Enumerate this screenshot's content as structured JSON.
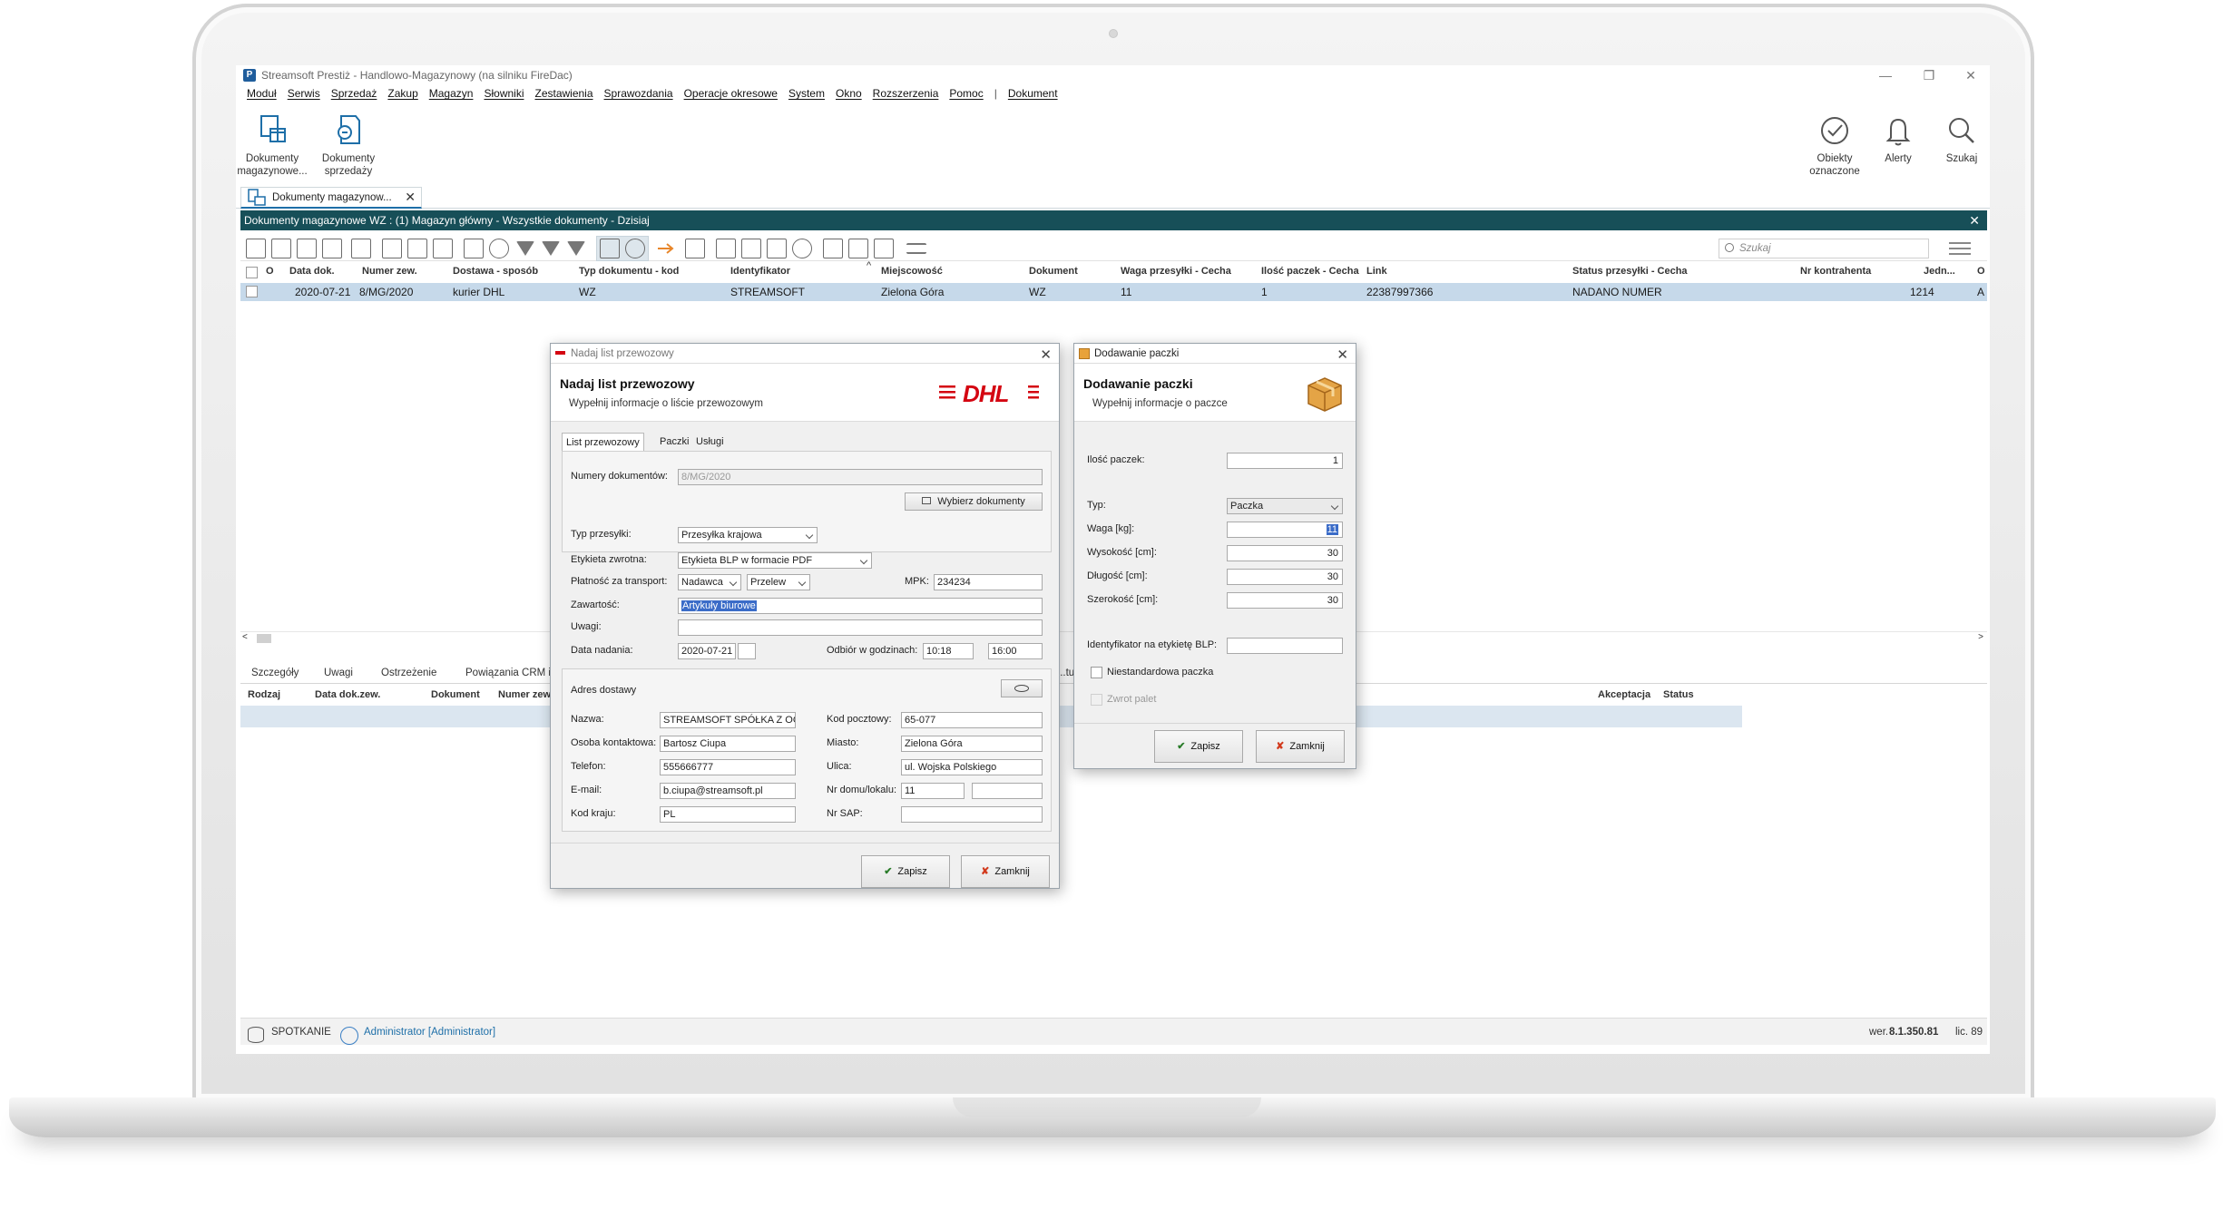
{
  "window": {
    "title": "Streamsoft Prestiż - Handlowo-Magazynowy (na silniku FireDac)",
    "app_letter": "P",
    "minimize": "—",
    "maximize": "❐",
    "close": "✕"
  },
  "menu": [
    "Moduł",
    "Serwis",
    "Sprzedaż",
    "Zakup",
    "Magazyn",
    "Słowniki",
    "Zestawienia",
    "Sprawozdania",
    "Operacje okresowe",
    "System",
    "Okno",
    "Rozszerzenia",
    "Pomoc",
    "|",
    "Dokument"
  ],
  "ribbon": {
    "docs_warehouse": "Dokumenty magazynowe...",
    "docs_sales": "Dokumenty sprzedaży",
    "marked": "Obiekty oznaczone",
    "alerts": "Alerty",
    "search": "Szukaj"
  },
  "doc_tab": {
    "label": "Dokumenty magazynow...",
    "close": "✕"
  },
  "breadcrumb": "Dokumenty magazynowe WZ : (1) Magazyn główny - Wszystkie dokumenty - Dzisiaj",
  "toolbar": {
    "search_placeholder": "Szukaj"
  },
  "grid": {
    "headers": {
      "mark": "O",
      "date": "Data dok.",
      "ext_no": "Numer zew.",
      "delivery": "Dostawa - sposób",
      "doc_type": "Typ dokumentu - kod",
      "identifier": "Identyfikator",
      "city": "Miejscowość",
      "document": "Dokument",
      "weight": "Waga przesyłki - Cecha",
      "packages": "Ilość paczek - Cecha",
      "link": "Link",
      "status": "Status przesyłki - Cecha",
      "contractor": "Nr kontrahenta",
      "unit": "Jedn...",
      "last": "O"
    },
    "row": {
      "date": "2020-07-21",
      "ext_no": "8/MG/2020",
      "delivery": "kurier DHL",
      "doc_type": "WZ",
      "identifier": "STREAMSOFT",
      "city": "Zielona Góra",
      "document": "WZ",
      "weight": "11",
      "packages": "1",
      "link": "22387997366",
      "status": "NADANO NUMER",
      "contractor": "1214",
      "unit": "A"
    }
  },
  "bottom_tabs": [
    "Szczegóły",
    "Uwagi",
    "Ostrzeżenie",
    "Powiązania CRM i ...",
    "...tu"
  ],
  "bottom_headers": {
    "kind": "Rodzaj",
    "date": "Data dok.zew.",
    "document": "Dokument",
    "number": "Numer zew...",
    "accept": "Akceptacja",
    "status": "Status"
  },
  "statusbar": {
    "db": "SPOTKANIE",
    "user": "Administrator [Administrator]",
    "version_label": "wer.",
    "version": "8.1.350.81",
    "license": "lic. 89"
  },
  "dhl_dialog": {
    "title": "Nadaj list przewozowy",
    "heading": "Nadaj list przewozowy",
    "subheading": "Wypełnij informacje o liście przewozowym",
    "logo": "DHL",
    "tabs": [
      "List przewozowy",
      "Paczki",
      "Usługi"
    ],
    "doc_numbers_label": "Numery dokumentów:",
    "doc_numbers": "8/MG/2020",
    "pick_docs": "Wybierz dokumenty",
    "shipment_type_label": "Typ przesyłki:",
    "shipment_type": "Przesyłka krajowa",
    "return_label_label": "Etykieta zwrotna:",
    "return_label": "Etykieta BLP w formacie PDF",
    "payment_label": "Płatność za transport:",
    "payer": "Nadawca",
    "method": "Przelew",
    "mpk_label": "MPK:",
    "mpk": "234234",
    "content_label": "Zawartość:",
    "content": "Artykuły biurowe",
    "notes_label": "Uwagi:",
    "notes": "",
    "send_date_label": "Data nadania:",
    "send_date": "2020-07-21",
    "pickup_label": "Odbiór w godzinach:",
    "pickup_from": "10:18",
    "pickup_to": "16:00",
    "address_label": "Adres dostawy",
    "name_label": "Nazwa:",
    "name": "STREAMSOFT SPÓŁKA Z OGR.",
    "contact_label": "Osoba kontaktowa:",
    "contact": "Bartosz Ciupa",
    "phone_label": "Telefon:",
    "phone": "555666777",
    "email_label": "E-mail:",
    "email": "b.ciupa@streamsoft.pl",
    "country_label": "Kod kraju:",
    "country": "PL",
    "postal_label": "Kod pocztowy:",
    "postal": "65-077",
    "city_label": "Miasto:",
    "city": "Zielona Góra",
    "street_label": "Ulica:",
    "street": "ul. Wojska Polskiego",
    "house_label": "Nr domu/lokalu:",
    "house": "11",
    "flat": "",
    "sap_label": "Nr SAP:",
    "sap": "",
    "save": "Zapisz",
    "close": "Zamknij"
  },
  "package_dialog": {
    "title": "Dodawanie paczki",
    "heading": "Dodawanie paczki",
    "subheading": "Wypełnij informacje o paczce",
    "count_label": "Ilość paczek:",
    "count": "1",
    "type_label": "Typ:",
    "type": "Paczka",
    "weight_label": "Waga [kg]:",
    "weight": "11",
    "height_label": "Wysokość [cm]:",
    "height": "30",
    "length_label": "Długość [cm]:",
    "length": "30",
    "width_label": "Szerokość [cm]:",
    "width": "30",
    "blp_label": "Identyfikator na etykietę BLP:",
    "blp": "",
    "nonstandard_label": "Niestandardowa paczka",
    "pallet_label": "Zwrot palet",
    "save": "Zapisz",
    "close": "Zamknij"
  },
  "colors": {
    "accent": "#174f58",
    "selection": "#c6d9ea",
    "dhl_red": "#d40511"
  }
}
